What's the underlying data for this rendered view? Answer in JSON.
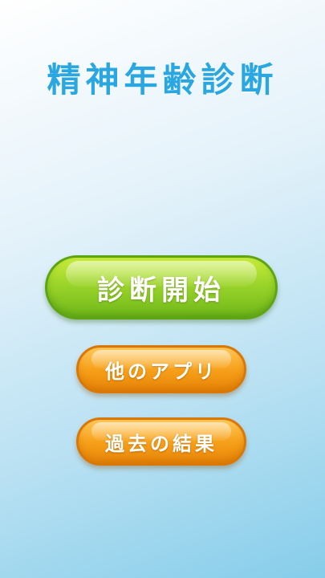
{
  "app": {
    "title": "精神年齢診断"
  },
  "buttons": {
    "start_label": "診断開始",
    "other_apps_label": "他のアプリ",
    "past_results_label": "過去の結果"
  },
  "colors": {
    "title": "#2aa7e0",
    "start_button": "#9bd42a",
    "secondary_button": "#f7a11b",
    "background_top": "#ffffff",
    "background_bottom": "#86cdea"
  }
}
